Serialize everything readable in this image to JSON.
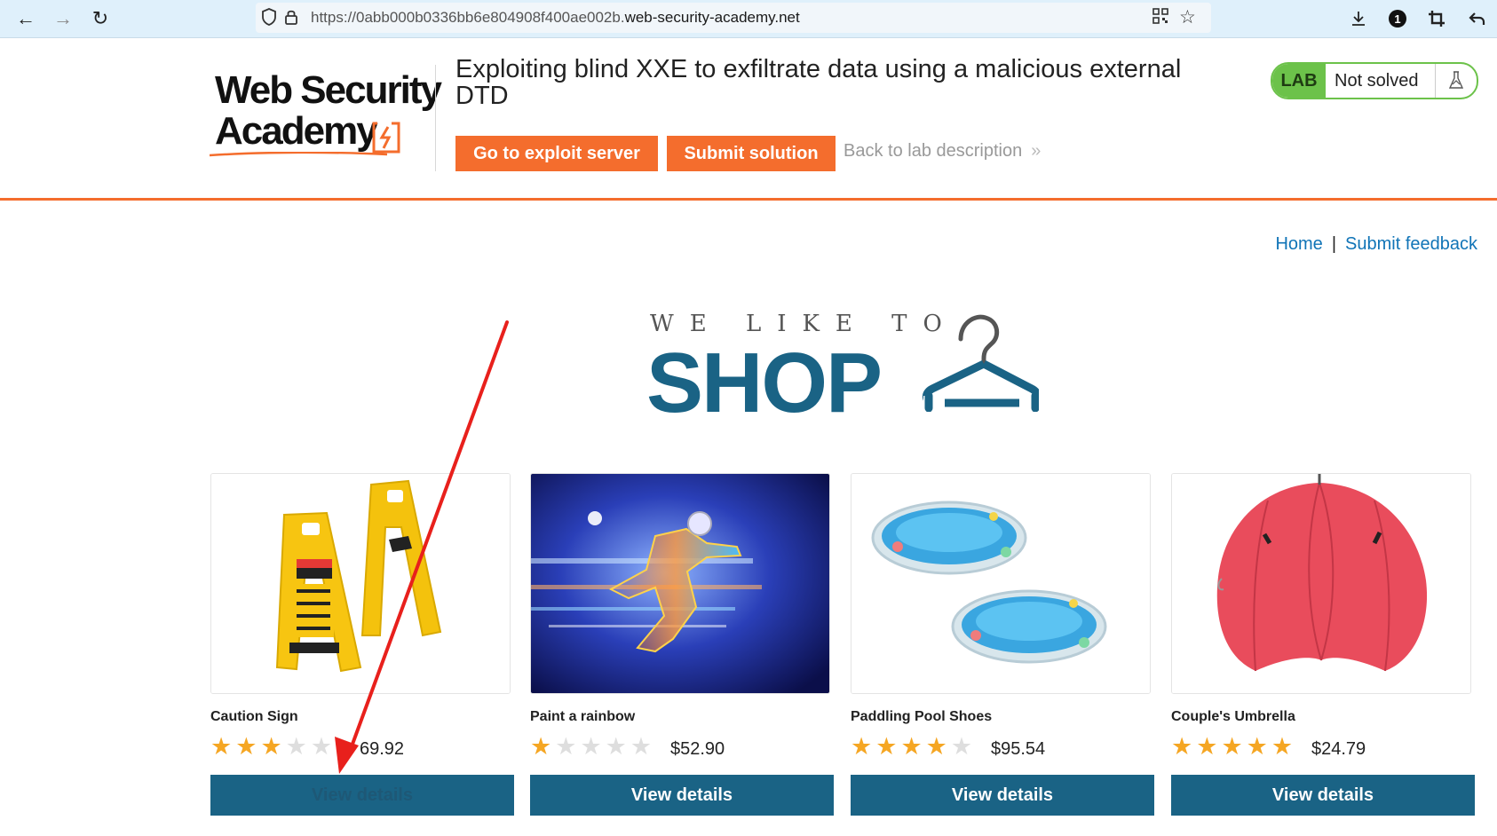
{
  "browser": {
    "url_prefix": "https://0abb000b0336bb6e804908f400ae002b.",
    "url_host": "web-security-academy.net",
    "notification_count": "1"
  },
  "header": {
    "logo_line1": "Web Security",
    "logo_line2": "Academy",
    "lab_title": "Exploiting blind XXE to exfiltrate data using a malicious external DTD",
    "exploit_button": "Go to exploit server",
    "submit_button": "Submit solution",
    "back_link": "Back to lab description",
    "badge_label": "LAB",
    "badge_status": "Not solved",
    "accent_color": "#f46d2d",
    "badge_color": "#6cc24a"
  },
  "nav": {
    "home": "Home",
    "separator": "|",
    "feedback": "Submit feedback"
  },
  "banner": {
    "tagline": "WE LIKE TO",
    "headline": "SHOP",
    "color": "#1a6385"
  },
  "products": [
    {
      "name": "Caution Sign",
      "rating": 3,
      "price": "$69.92",
      "price_visible": "69.92",
      "button": "View details"
    },
    {
      "name": "Paint a rainbow",
      "rating": 1,
      "price": "$52.90",
      "button": "View details"
    },
    {
      "name": "Paddling Pool Shoes",
      "rating": 4,
      "price": "$95.54",
      "button": "View details"
    },
    {
      "name": "Couple's Umbrella",
      "rating": 5,
      "price": "$24.79",
      "button": "View details"
    }
  ],
  "annotation": {
    "arrow_color": "#e8201c"
  }
}
